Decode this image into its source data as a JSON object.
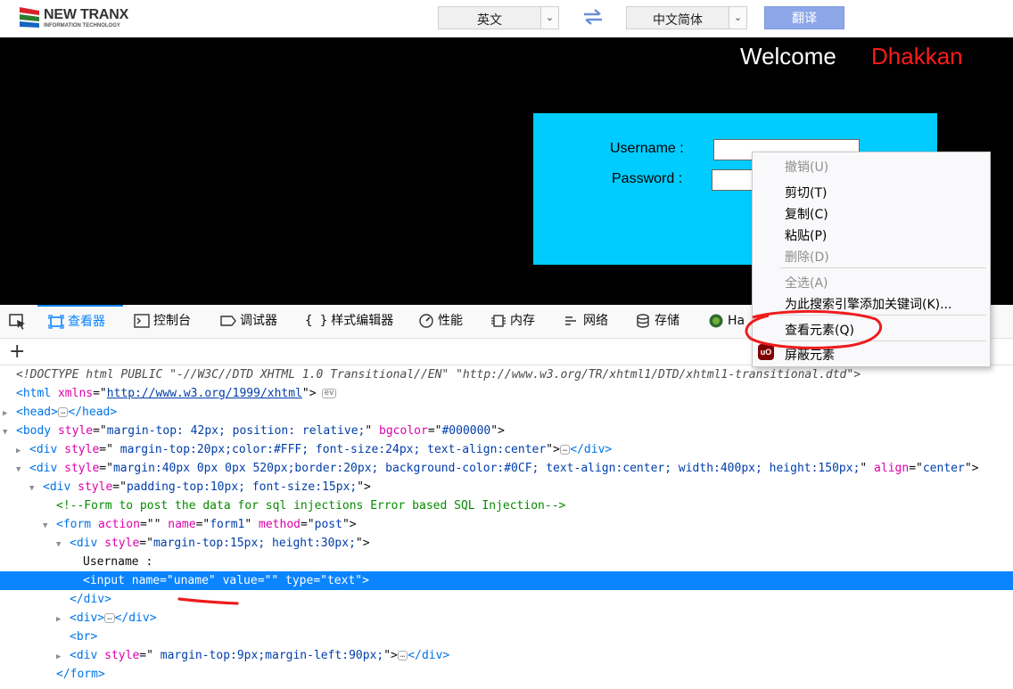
{
  "translator": {
    "logo_main": "NEW TRANX",
    "logo_sub": "INFORMATION TECHNOLOGY",
    "source_lang": "英文",
    "target_lang": "中文简体",
    "translate_button": "翻译",
    "swap_icon": "swap-arrows-icon"
  },
  "page": {
    "welcome": "Welcome",
    "welcome_name": "Dhakkan",
    "username_label": "Username :",
    "password_label": "Password :",
    "colors": {
      "background": "#000000",
      "login_box": "#00ccff",
      "name_color": "#ff1a1a"
    }
  },
  "devtools": {
    "tabs": [
      {
        "label": "查看器",
        "icon": "inspector-icon",
        "active": true
      },
      {
        "label": "控制台",
        "icon": "console-icon"
      },
      {
        "label": "调试器",
        "icon": "debugger-icon"
      },
      {
        "label": "样式编辑器",
        "icon": "braces-icon"
      },
      {
        "label": "性能",
        "icon": "performance-icon"
      },
      {
        "label": "内存",
        "icon": "memory-icon"
      },
      {
        "label": "网络",
        "icon": "network-icon"
      },
      {
        "label": "存储",
        "icon": "storage-icon"
      },
      {
        "label": "Ha",
        "icon": "hackbar-icon"
      }
    ],
    "add_node": "+",
    "markup": [
      {
        "indent": 0,
        "twisty": "",
        "parts": [
          [
            "dt",
            "<!DOCTYPE html PUBLIC \"-//W3C//DTD XHTML 1.0 Transitional//EN\" \"http://www.w3.org/TR/xhtml1/DTD/xhtml1-transitional.dtd\">"
          ]
        ]
      },
      {
        "indent": 0,
        "twisty": "",
        "parts": [
          [
            "tag",
            "<html "
          ],
          [
            "an",
            "xmlns"
          ],
          [
            "txt",
            "=\""
          ],
          [
            "url",
            "http://www.w3.org/1999/xhtml"
          ],
          [
            "txt",
            "\">"
          ],
          [
            "ev",
            "ev"
          ]
        ]
      },
      {
        "indent": 0,
        "twisty": "▶",
        "parts": [
          [
            "tag",
            "<head>"
          ],
          [
            "ell",
            "…"
          ],
          [
            "tag",
            "</head>"
          ]
        ]
      },
      {
        "indent": 0,
        "twisty": "▼",
        "parts": [
          [
            "tag",
            "<body "
          ],
          [
            "an",
            "style"
          ],
          [
            "txt",
            "=\""
          ],
          [
            "av",
            "margin-top: 42px; position: relative;"
          ],
          [
            "txt",
            "\" "
          ],
          [
            "an",
            "bgcolor"
          ],
          [
            "txt",
            "=\""
          ],
          [
            "av",
            "#000000"
          ],
          [
            "txt",
            "\">"
          ]
        ]
      },
      {
        "indent": 1,
        "twisty": "▶",
        "parts": [
          [
            "tag",
            "<div "
          ],
          [
            "an",
            "style"
          ],
          [
            "txt",
            "=\""
          ],
          [
            "av",
            " margin-top:20px;color:#FFF; font-size:24px; text-align:center"
          ],
          [
            "txt",
            "\">"
          ],
          [
            "ell",
            "…"
          ],
          [
            "tag",
            "</div>"
          ]
        ]
      },
      {
        "indent": 1,
        "twisty": "▼",
        "parts": [
          [
            "tag",
            "<div "
          ],
          [
            "an",
            "style"
          ],
          [
            "txt",
            "=\""
          ],
          [
            "av",
            "margin:40px 0px 0px 520px;border:20px; background-color:#0CF; text-align:center; width:400px; height:150px;"
          ],
          [
            "txt",
            "\" "
          ],
          [
            "an",
            "align"
          ],
          [
            "txt",
            "=\""
          ],
          [
            "av",
            "center"
          ],
          [
            "txt",
            "\">"
          ]
        ]
      },
      {
        "indent": 2,
        "twisty": "▼",
        "parts": [
          [
            "tag",
            "<div "
          ],
          [
            "an",
            "style"
          ],
          [
            "txt",
            "=\""
          ],
          [
            "av",
            "padding-top:10px; font-size:15px;"
          ],
          [
            "txt",
            "\">"
          ]
        ]
      },
      {
        "indent": 3,
        "twisty": "",
        "parts": [
          [
            "cm",
            "<!--Form to post the data for sql injections Error based SQL Injection-->"
          ]
        ]
      },
      {
        "indent": 3,
        "twisty": "▼",
        "parts": [
          [
            "tag",
            "<form "
          ],
          [
            "an",
            "action"
          ],
          [
            "txt",
            "=\"\" "
          ],
          [
            "an",
            "name"
          ],
          [
            "txt",
            "=\""
          ],
          [
            "av",
            "form1"
          ],
          [
            "txt",
            "\" "
          ],
          [
            "an",
            "method"
          ],
          [
            "txt",
            "=\""
          ],
          [
            "av",
            "post"
          ],
          [
            "txt",
            "\">"
          ]
        ]
      },
      {
        "indent": 4,
        "twisty": "▼",
        "parts": [
          [
            "tag",
            "<div "
          ],
          [
            "an",
            "style"
          ],
          [
            "txt",
            "=\""
          ],
          [
            "av",
            "margin-top:15px; height:30px;"
          ],
          [
            "txt",
            "\">"
          ]
        ]
      },
      {
        "indent": 5,
        "twisty": "",
        "parts": [
          [
            "txt",
            "Username :"
          ]
        ]
      },
      {
        "indent": 5,
        "twisty": "",
        "selected": true,
        "parts": [
          [
            "tag",
            "<input "
          ],
          [
            "an",
            "name"
          ],
          [
            "txt",
            "=\""
          ],
          [
            "av",
            "uname"
          ],
          [
            "txt",
            "\" "
          ],
          [
            "an",
            "value"
          ],
          [
            "txt",
            "=\"\" "
          ],
          [
            "an",
            "type"
          ],
          [
            "txt",
            "=\""
          ],
          [
            "av",
            "text"
          ],
          [
            "txt",
            "\">"
          ]
        ]
      },
      {
        "indent": 4,
        "twisty": "",
        "parts": [
          [
            "tag",
            "</div>"
          ]
        ]
      },
      {
        "indent": 4,
        "twisty": "▶",
        "parts": [
          [
            "tag",
            "<div>"
          ],
          [
            "ell",
            "…"
          ],
          [
            "tag",
            "</div>"
          ]
        ]
      },
      {
        "indent": 4,
        "twisty": "",
        "parts": [
          [
            "tag",
            "<br>"
          ]
        ]
      },
      {
        "indent": 4,
        "twisty": "▶",
        "parts": [
          [
            "tag",
            "<div "
          ],
          [
            "an",
            "style"
          ],
          [
            "txt",
            "=\""
          ],
          [
            "av",
            " margin-top:9px;margin-left:90px;"
          ],
          [
            "txt",
            "\">"
          ],
          [
            "ell",
            "…"
          ],
          [
            "tag",
            "</div>"
          ]
        ]
      },
      {
        "indent": 3,
        "twisty": "",
        "parts": [
          [
            "tag",
            "</form>"
          ]
        ]
      }
    ]
  },
  "context_menu": {
    "items": [
      {
        "label": "撤销(U)",
        "disabled": true
      },
      {
        "label": "剪切(T)"
      },
      {
        "label": "复制(C)"
      },
      {
        "label": "粘贴(P)"
      },
      {
        "label": "删除(D)",
        "disabled": true
      },
      {
        "label": "全选(A)",
        "disabled": true
      },
      {
        "label": "为此搜索引擎添加关键词(K)..."
      },
      {
        "label": "查看元素(Q)"
      },
      {
        "label": "屏蔽元素",
        "icon": "ublock-icon"
      }
    ],
    "ublock_icon_text": "uO"
  }
}
